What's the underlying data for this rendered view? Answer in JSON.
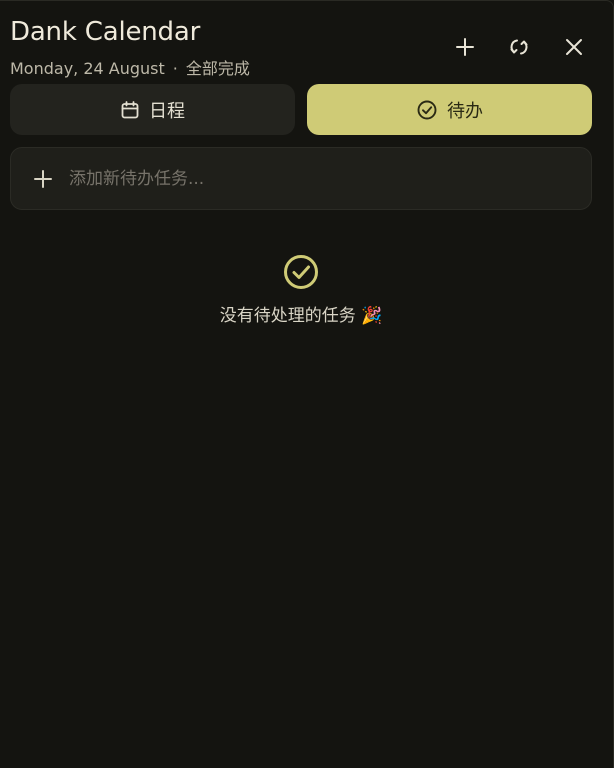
{
  "app": {
    "title": "Dank Calendar",
    "date": "Monday, 24 August",
    "separator": "·",
    "status": "全部完成"
  },
  "header_buttons": {
    "add_icon": "plus-icon",
    "sync_icon": "sync-icon",
    "close_icon": "close-icon"
  },
  "tabs": [
    {
      "label": "日程",
      "icon": "calendar-icon",
      "active": false
    },
    {
      "label": "待办",
      "icon": "check-circle-icon",
      "active": true
    }
  ],
  "new_task": {
    "placeholder": "添加新待办任务...",
    "value": ""
  },
  "empty_state": {
    "icon": "check-circle-icon",
    "message": "没有待处理的任务 🎉"
  },
  "colors": {
    "background": "#141410",
    "accent": "#cfcb76",
    "surface": "#23231e",
    "text": "#efeadb"
  }
}
